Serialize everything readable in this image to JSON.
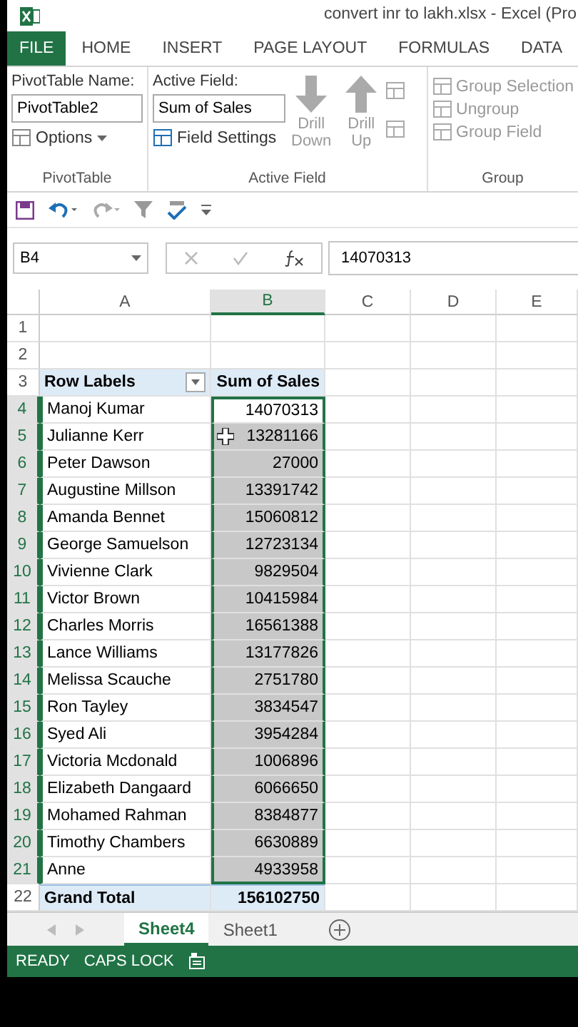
{
  "window": {
    "title": "convert inr to lakh.xlsx - Excel (Pro"
  },
  "ribbon_tabs": [
    {
      "label": "FILE",
      "selected": false,
      "kind": "file"
    },
    {
      "label": "HOME",
      "selected": false,
      "kind": "tab"
    },
    {
      "label": "INSERT",
      "selected": false,
      "kind": "tab"
    },
    {
      "label": "PAGE LAYOUT",
      "selected": false,
      "kind": "tab"
    },
    {
      "label": "FORMULAS",
      "selected": false,
      "kind": "tab"
    },
    {
      "label": "DATA",
      "selected": false,
      "kind": "tab"
    }
  ],
  "ribbon": {
    "pivottable": {
      "name_label": "PivotTable Name:",
      "name_value": "PivotTable2",
      "options": "Options",
      "group_label": "PivotTable"
    },
    "active_field": {
      "field_label": "Active Field:",
      "field_value": "Sum of Sales",
      "field_settings": "Field Settings",
      "drill_down": [
        "Drill",
        "Down"
      ],
      "drill_up": [
        "Drill",
        "Up"
      ],
      "group_label": "Active Field"
    },
    "group": {
      "items": [
        "Group Selection",
        "Ungroup",
        "Group Field"
      ],
      "group_label": "Group"
    }
  },
  "formula_bar": {
    "name_box": "B4",
    "value": "14070313"
  },
  "columns": [
    {
      "label": "A",
      "selected": false
    },
    {
      "label": "B",
      "selected": true
    },
    {
      "label": "C",
      "selected": false
    },
    {
      "label": "D",
      "selected": false
    },
    {
      "label": "E",
      "selected": false
    }
  ],
  "rows": [
    {
      "number": "1",
      "kind": "blank",
      "selected": false,
      "active": false
    },
    {
      "number": "2",
      "kind": "blank",
      "selected": false,
      "active": false
    },
    {
      "number": "3",
      "kind": "header",
      "label": "Row Labels",
      "value": "Sum of Sales",
      "selected": false,
      "active": false
    },
    {
      "number": "4",
      "kind": "data",
      "label": "Manoj Kumar",
      "value": "14070313",
      "selected": true,
      "active": true
    },
    {
      "number": "5",
      "kind": "data",
      "label": "Julianne Kerr",
      "value": "13281166",
      "selected": true,
      "active": false
    },
    {
      "number": "6",
      "kind": "data",
      "label": "Peter Dawson",
      "value": "27000",
      "selected": true,
      "active": false
    },
    {
      "number": "7",
      "kind": "data",
      "label": "Augustine Millson",
      "value": "13391742",
      "selected": true,
      "active": false
    },
    {
      "number": "8",
      "kind": "data",
      "label": "Amanda Bennet",
      "value": "15060812",
      "selected": true,
      "active": false
    },
    {
      "number": "9",
      "kind": "data",
      "label": "George Samuelson",
      "value": "12723134",
      "selected": true,
      "active": false
    },
    {
      "number": "10",
      "kind": "data",
      "label": "Vivienne Clark",
      "value": "9829504",
      "selected": true,
      "active": false
    },
    {
      "number": "11",
      "kind": "data",
      "label": "Victor Brown",
      "value": "10415984",
      "selected": true,
      "active": false
    },
    {
      "number": "12",
      "kind": "data",
      "label": "Charles Morris",
      "value": "16561388",
      "selected": true,
      "active": false
    },
    {
      "number": "13",
      "kind": "data",
      "label": "Lance Williams",
      "value": "13177826",
      "selected": true,
      "active": false
    },
    {
      "number": "14",
      "kind": "data",
      "label": "Melissa Scauche",
      "value": "2751780",
      "selected": true,
      "active": false
    },
    {
      "number": "15",
      "kind": "data",
      "label": "Ron Tayley",
      "value": "3834547",
      "selected": true,
      "active": false
    },
    {
      "number": "16",
      "kind": "data",
      "label": "Syed Ali",
      "value": "3954284",
      "selected": true,
      "active": false
    },
    {
      "number": "17",
      "kind": "data",
      "label": "Victoria Mcdonald",
      "value": "1006896",
      "selected": true,
      "active": false
    },
    {
      "number": "18",
      "kind": "data",
      "label": "Elizabeth Dangaard",
      "value": "6066650",
      "selected": true,
      "active": false
    },
    {
      "number": "19",
      "kind": "data",
      "label": "Mohamed Rahman",
      "value": "8384877",
      "selected": true,
      "active": false
    },
    {
      "number": "20",
      "kind": "data",
      "label": "Timothy Chambers",
      "value": "6630889",
      "selected": true,
      "active": false
    },
    {
      "number": "21",
      "kind": "data",
      "label": "Anne",
      "value": "4933958",
      "selected": true,
      "active": false
    },
    {
      "number": "22",
      "kind": "total",
      "label": "Grand Total",
      "value": "156102750",
      "selected": false,
      "active": false
    }
  ],
  "sheet_tabs": [
    {
      "label": "Sheet4",
      "selected": true
    },
    {
      "label": "Sheet1",
      "selected": false
    }
  ],
  "status_bar": [
    "READY",
    "CAPS LOCK"
  ]
}
